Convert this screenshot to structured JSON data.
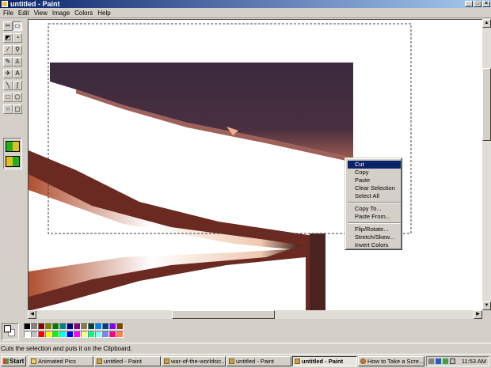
{
  "window": {
    "title": "untitled - Paint"
  },
  "menu": [
    "File",
    "Edit",
    "View",
    "Image",
    "Colors",
    "Help"
  ],
  "tools": [
    {
      "icon": "free-form-select-icon",
      "glyph": "✂"
    },
    {
      "icon": "rect-select-icon",
      "glyph": "▭"
    },
    {
      "icon": "eraser-icon",
      "glyph": "◩"
    },
    {
      "icon": "fill-icon",
      "glyph": "◔"
    },
    {
      "icon": "color-picker-icon",
      "glyph": "⁄"
    },
    {
      "icon": "magnifier-icon",
      "glyph": "⚲"
    },
    {
      "icon": "pencil-icon",
      "glyph": "✎"
    },
    {
      "icon": "brush-icon",
      "glyph": "♙"
    },
    {
      "icon": "airbrush-icon",
      "glyph": "✈"
    },
    {
      "icon": "text-icon",
      "glyph": "A"
    },
    {
      "icon": "line-icon",
      "glyph": "╲"
    },
    {
      "icon": "curve-icon",
      "glyph": "∫"
    },
    {
      "icon": "rectangle-icon",
      "glyph": "□"
    },
    {
      "icon": "polygon-icon",
      "glyph": "⬠"
    },
    {
      "icon": "ellipse-icon",
      "glyph": "○"
    },
    {
      "icon": "rounded-rectangle-icon",
      "glyph": "▢"
    }
  ],
  "palette": [
    "#000000",
    "#808080",
    "#800000",
    "#808000",
    "#008000",
    "#008080",
    "#000080",
    "#800080",
    "#808040",
    "#004040",
    "#0080ff",
    "#004080",
    "#8000ff",
    "#804000",
    "#ffffff",
    "#c0c0c0",
    "#ff0000",
    "#ffff00",
    "#00ff00",
    "#00ffff",
    "#0000ff",
    "#ff00ff",
    "#ffff80",
    "#00ff80",
    "#80ffff",
    "#8080ff",
    "#ff0080",
    "#ff8040"
  ],
  "context_menu": {
    "items": [
      "Cut",
      "Copy",
      "Paste",
      "Clear Selection",
      "Select All",
      "Copy To...",
      "Paste From...",
      "Flip/Rotate...",
      "Stretch/Skew...",
      "Invert Colors"
    ],
    "highlighted": "Cut"
  },
  "status": "Cuts the selection and puts it on the Clipboard.",
  "taskbar": {
    "start": "Start",
    "tasks": [
      "Animated Pics",
      "untitled - Paint",
      "war-of-the-worldsic...",
      "untitled - Paint",
      "untitled - Paint",
      "How to Take a Scre..."
    ],
    "active_task": "untitled - Paint",
    "clock": "11:53 AM"
  }
}
